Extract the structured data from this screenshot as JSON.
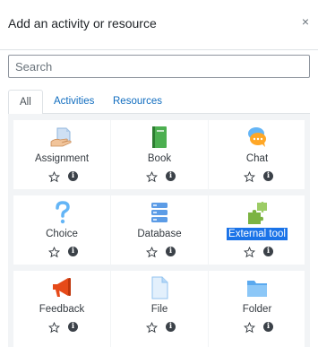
{
  "header": {
    "title": "Add an activity or resource",
    "close_symbol": "×"
  },
  "search": {
    "placeholder": "Search"
  },
  "tabs": [
    "All",
    "Activities",
    "Resources"
  ],
  "info_glyph": "i",
  "activities": [
    {
      "label": "Assignment",
      "icon": "assignment-icon",
      "highlighted": false
    },
    {
      "label": "Book",
      "icon": "book-icon",
      "highlighted": false
    },
    {
      "label": "Chat",
      "icon": "chat-icon",
      "highlighted": false
    },
    {
      "label": "Choice",
      "icon": "choice-icon",
      "highlighted": false
    },
    {
      "label": "Database",
      "icon": "database-icon",
      "highlighted": false
    },
    {
      "label": "External tool",
      "icon": "puzzle-icon",
      "highlighted": true
    },
    {
      "label": "Feedback",
      "icon": "megaphone-icon",
      "highlighted": false
    },
    {
      "label": "File",
      "icon": "file-icon",
      "highlighted": false
    },
    {
      "label": "Folder",
      "icon": "folder-icon",
      "highlighted": false
    }
  ],
  "colors": {
    "link": "#0f6cbf",
    "selection": "#1a73e8"
  }
}
